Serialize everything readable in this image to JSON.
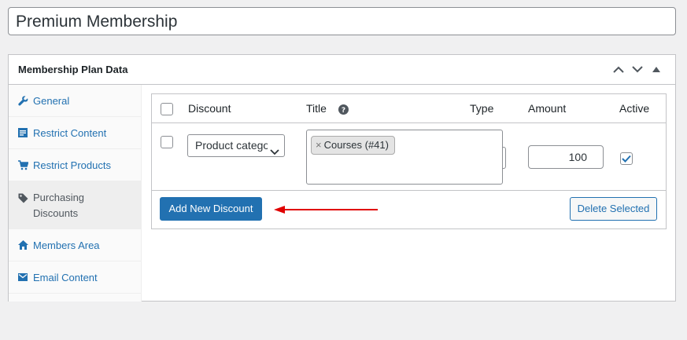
{
  "post_title": "Premium Membership",
  "metabox": {
    "title": "Membership Plan Data",
    "controls": [
      "chevron-up-icon",
      "chevron-down-icon",
      "toggle-triangle-icon"
    ]
  },
  "tabs": [
    {
      "label": "General",
      "icon": "wrench-icon",
      "active": false
    },
    {
      "label": "Restrict Content",
      "icon": "document-icon",
      "active": false
    },
    {
      "label": "Restrict Products",
      "icon": "cart-icon",
      "active": false
    },
    {
      "label": "Purchasing Discounts",
      "icon": "tag-icon",
      "active": true
    },
    {
      "label": "Members Area",
      "icon": "home-icon",
      "active": false
    },
    {
      "label": "Email Content",
      "icon": "email-icon",
      "active": false
    }
  ],
  "table": {
    "columns": {
      "discount": "Discount",
      "title": "Title",
      "type": "Type",
      "amount": "Amount",
      "active": "Active"
    },
    "help_icon": "help-icon",
    "row": {
      "discount_select": "Product category",
      "title_tag": "Courses (#41)",
      "tag_remove": "×",
      "amount": "100",
      "active_checked": true,
      "selected": false
    }
  },
  "buttons": {
    "add_new": "Add New Discount",
    "delete_selected": "Delete Selected"
  },
  "colors": {
    "accent": "#2271b1",
    "annotation_arrow": "#e00000"
  }
}
